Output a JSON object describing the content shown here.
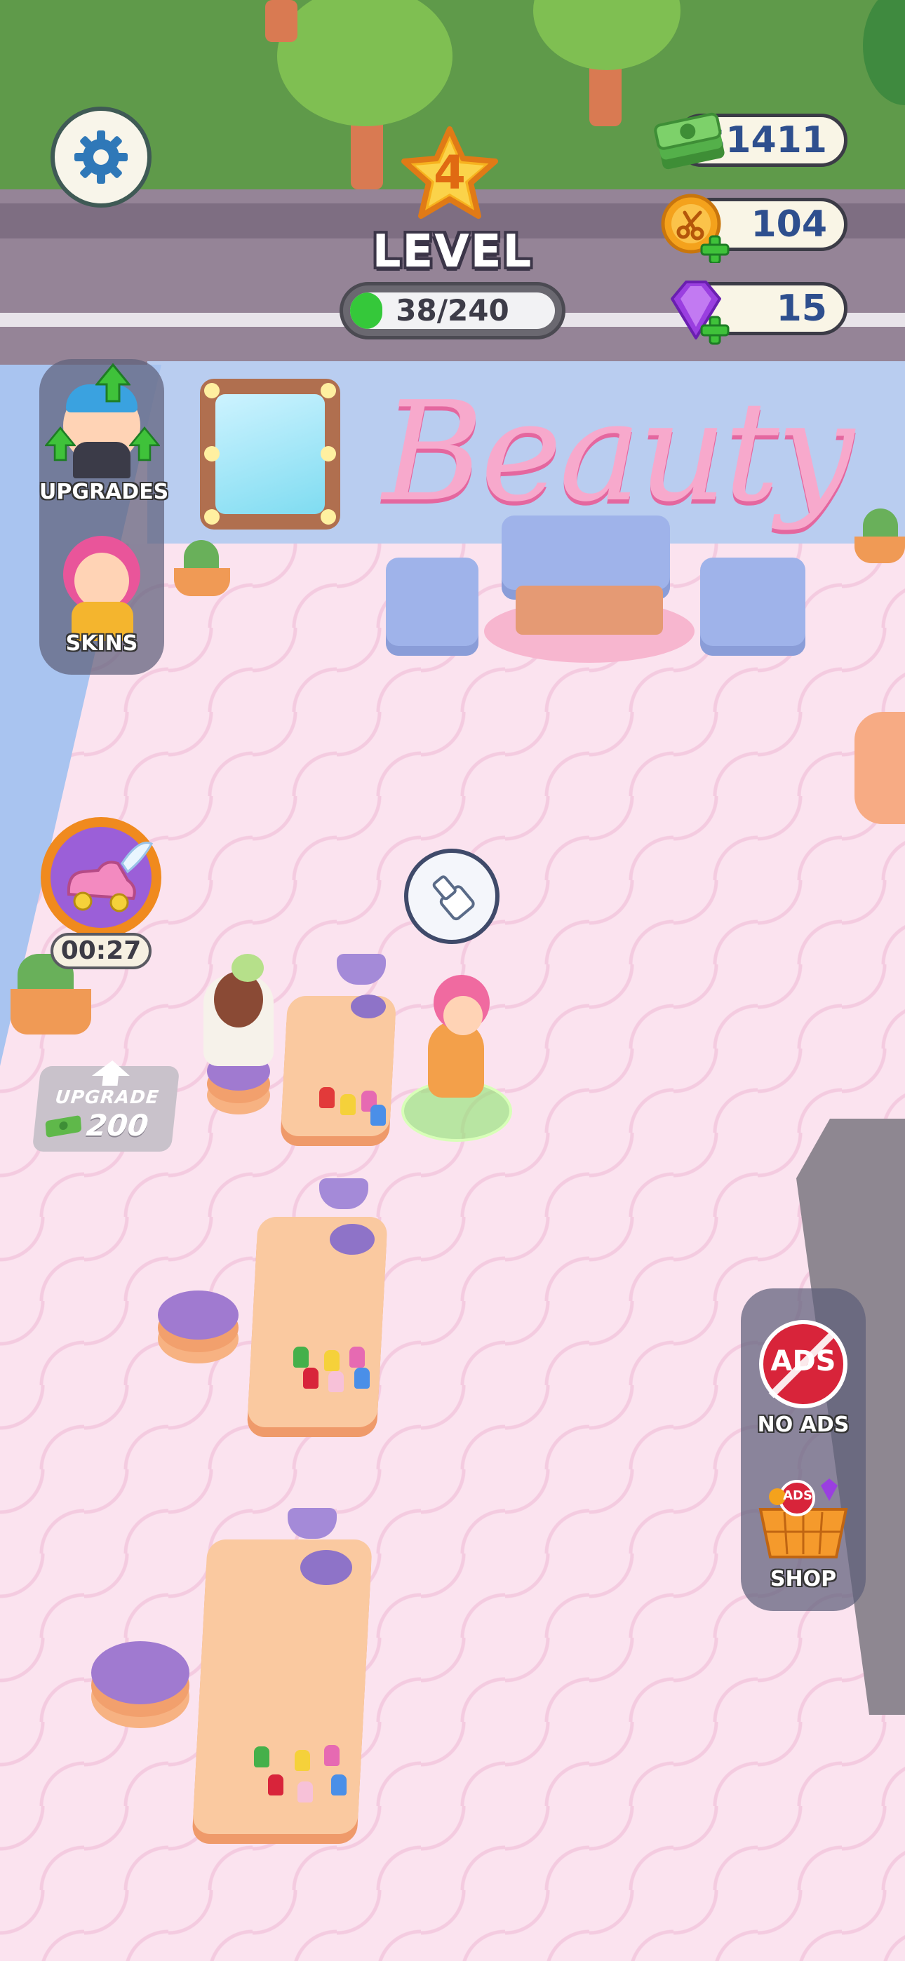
{
  "hud": {
    "settings_icon": "gear-icon",
    "level": {
      "number": "4",
      "label": "LEVEL",
      "progress_text": "38/240",
      "progress_fraction": 0.158
    },
    "currencies": {
      "cash": {
        "value": "$1411",
        "icon": "cash-stack-icon"
      },
      "scissor_tokens": {
        "value": "104",
        "icon": "scissors-coin-icon",
        "add_icon": "plus-icon"
      },
      "gems": {
        "value": "15",
        "icon": "gem-icon",
        "add_icon": "plus-icon"
      }
    }
  },
  "left_menu": {
    "upgrades_label": "UPGRADES",
    "skins_label": "SKINS"
  },
  "boost": {
    "icon": "winged-shoe-icon",
    "timer": "00:27"
  },
  "upgrade_pad": {
    "title": "UPGRADE",
    "price": "200",
    "icon": "cash-icon"
  },
  "right_menu": {
    "no_ads_icon_text": "ADS",
    "no_ads_label": "NO ADS",
    "shop_icon_text": "ADS",
    "shop_label": "SHOP"
  },
  "scene": {
    "sign_text": "Beauty",
    "task_icon": "nail-polish-task-icon"
  },
  "colors": {
    "accent_green": "#35c83a",
    "pill_text": "#2e4f8e",
    "no_ads_red": "#d8243a",
    "gem_purple": "#9a3fe0",
    "coin_orange": "#f4a21c"
  }
}
